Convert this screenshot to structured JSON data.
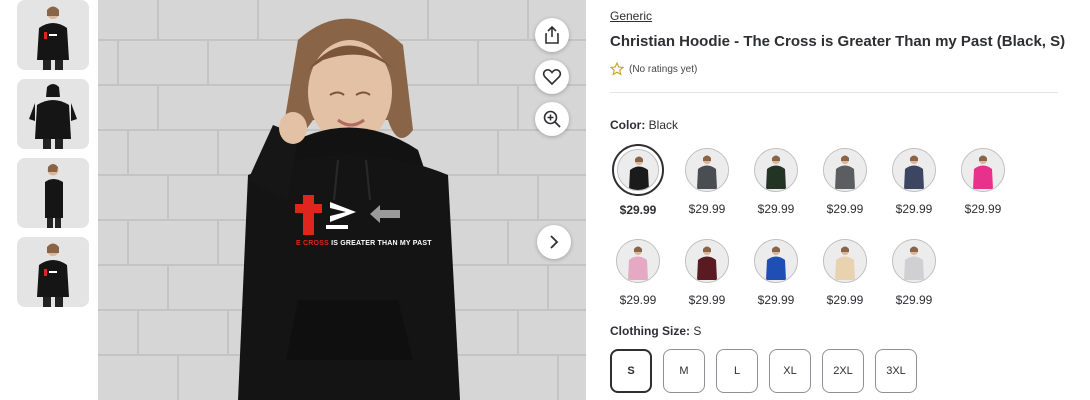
{
  "thumbnails": [
    {
      "alt": "front view",
      "icon": "hoodie-thumbnail-front"
    },
    {
      "alt": "back view",
      "icon": "hoodie-thumbnail-back"
    },
    {
      "alt": "side view",
      "icon": "hoodie-thumbnail-side"
    },
    {
      "alt": "front view 2",
      "icon": "hoodie-thumbnail-front2"
    }
  ],
  "main_image": {
    "print_text_red": "E CROSS",
    "print_text_white": " IS GREATER THAN MY PAST",
    "buttons": {
      "share": "share-icon",
      "favorite": "heart-icon",
      "zoom": "zoom-in-icon",
      "next": "chevron-right-icon"
    }
  },
  "product": {
    "brand": "Generic",
    "title": "Christian Hoodie - The Cross is Greater Than my Past (Black, S)",
    "rating_text": "(No ratings yet)"
  },
  "color_option": {
    "label": "Color:",
    "value": "Black",
    "swatches": [
      {
        "color": "#1b1b1b",
        "price": "$29.99",
        "selected": true
      },
      {
        "color": "#4a4d52",
        "price": "$29.99",
        "selected": false
      },
      {
        "color": "#243424",
        "price": "$29.99",
        "selected": false
      },
      {
        "color": "#5b5d60",
        "price": "$29.99",
        "selected": false
      },
      {
        "color": "#3c4660",
        "price": "$29.99",
        "selected": false
      },
      {
        "color": "#e8318a",
        "price": "$29.99",
        "selected": false
      },
      {
        "color": "#e6a9c4",
        "price": "$29.99",
        "selected": false
      },
      {
        "color": "#5a1a22",
        "price": "$29.99",
        "selected": false
      },
      {
        "color": "#1f4fb5",
        "price": "$29.99",
        "selected": false
      },
      {
        "color": "#e8d2b0",
        "price": "$29.99",
        "selected": false
      },
      {
        "color": "#d0d0d2",
        "price": "$29.99",
        "selected": false
      }
    ]
  },
  "size_option": {
    "label": "Clothing Size:",
    "value": "S",
    "sizes": [
      {
        "label": "S",
        "selected": true
      },
      {
        "label": "M",
        "selected": false
      },
      {
        "label": "L",
        "selected": false
      },
      {
        "label": "XL",
        "selected": false
      },
      {
        "label": "2XL",
        "selected": false
      },
      {
        "label": "3XL",
        "selected": false
      }
    ]
  },
  "colors": {
    "text": "#2e2f32",
    "star": "#c8a02a",
    "cross_red": "#e0251f"
  }
}
